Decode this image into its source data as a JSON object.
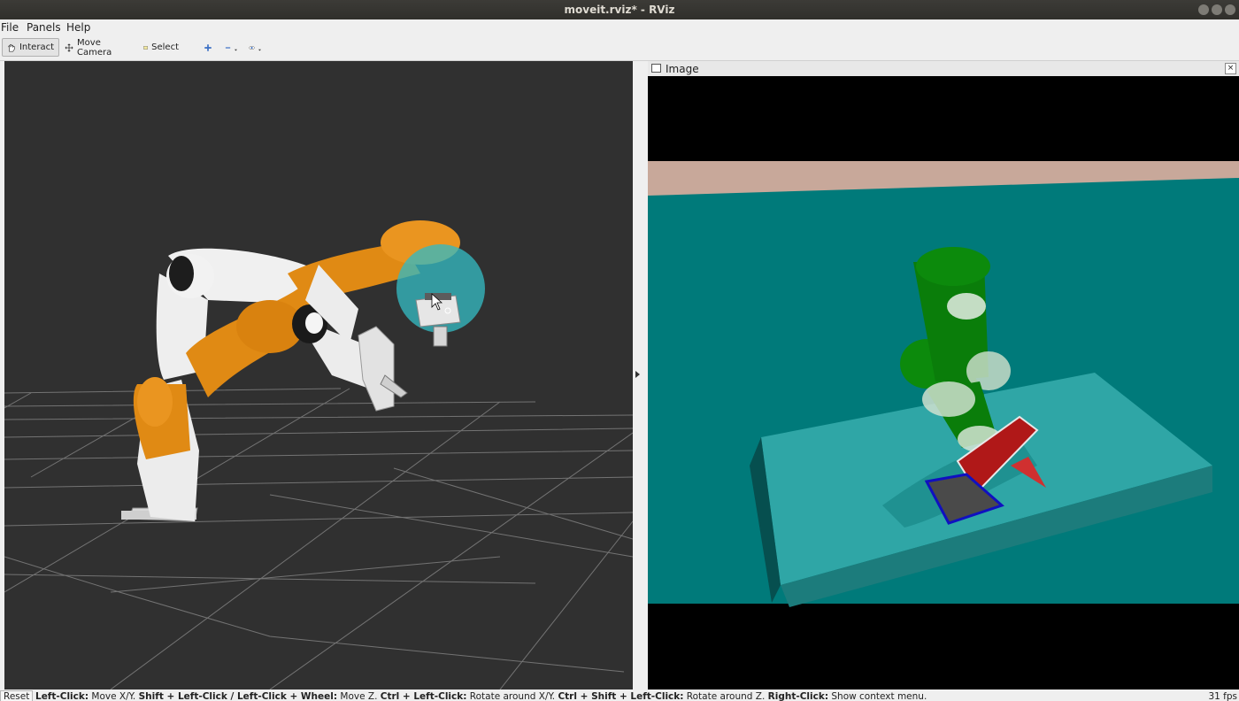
{
  "window": {
    "title": "moveit.rviz* - RViz"
  },
  "menu": {
    "items": [
      "File",
      "Panels",
      "Help"
    ]
  },
  "toolbar": {
    "interact": "Interact",
    "move_camera": "Move Camera",
    "select": "Select"
  },
  "image_panel": {
    "title": "Image"
  },
  "status": {
    "reset": "Reset",
    "hints": [
      {
        "key": "Left-Click:",
        "action": " Move X/Y. "
      },
      {
        "key": "Shift + Left-Click / Left-Click + Wheel:",
        "action": " Move Z. "
      },
      {
        "key": "Ctrl + Left-Click:",
        "action": " Rotate around X/Y. "
      },
      {
        "key": "Ctrl + Shift + Left-Click:",
        "action": " Rotate around Z. "
      },
      {
        "key": "Right-Click:",
        "action": " Show context menu."
      }
    ],
    "fps": "31 fps"
  },
  "colors": {
    "viewport_bg": "#303030",
    "robot_orange": "#e08a14",
    "robot_white": "#e8e8e8",
    "marker_cyan": "#35b8c0",
    "image_floor": "#007a7a",
    "image_wall": "#c8a89a",
    "table": "#2fa6a6",
    "robot_green": "#0a7d0a",
    "gripper_red": "#b01818"
  }
}
